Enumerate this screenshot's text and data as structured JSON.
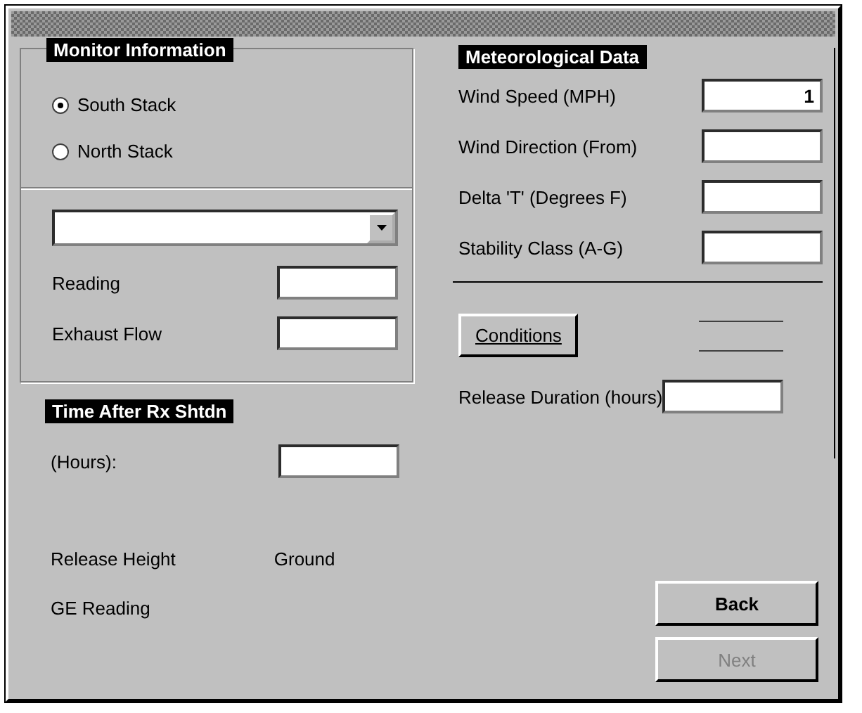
{
  "monitor_information": {
    "title": "Monitor Information",
    "radios": [
      {
        "label": "South Stack",
        "selected": true
      },
      {
        "label": "North Stack",
        "selected": false
      }
    ],
    "fields": [
      {
        "label": "Reading"
      },
      {
        "label": "Exhaust Flow"
      }
    ]
  },
  "time_after_shutdown": {
    "title": "Time After Rx Shtdn",
    "fields": [
      {
        "label": "(Hours):"
      }
    ]
  },
  "release_height": {
    "label": "Release Height",
    "value": "Ground"
  },
  "ge_reading": {
    "label": "GE Reading"
  },
  "meteorological_data": {
    "title": "Meteorological Data",
    "fields": [
      {
        "label": "Wind Speed (MPH)",
        "value": "1"
      },
      {
        "label": "Wind Direction (From)"
      },
      {
        "label": "Delta 'T' (Degrees F)"
      },
      {
        "label": "Stability Class (A-G)"
      }
    ]
  },
  "conditions_button": {
    "label": "Conditions"
  },
  "release_duration": {
    "label": "Release Duration (hours)"
  },
  "buttons": [
    {
      "label": "Back",
      "disabled": false
    },
    {
      "label": "Next",
      "disabled": true
    }
  ]
}
